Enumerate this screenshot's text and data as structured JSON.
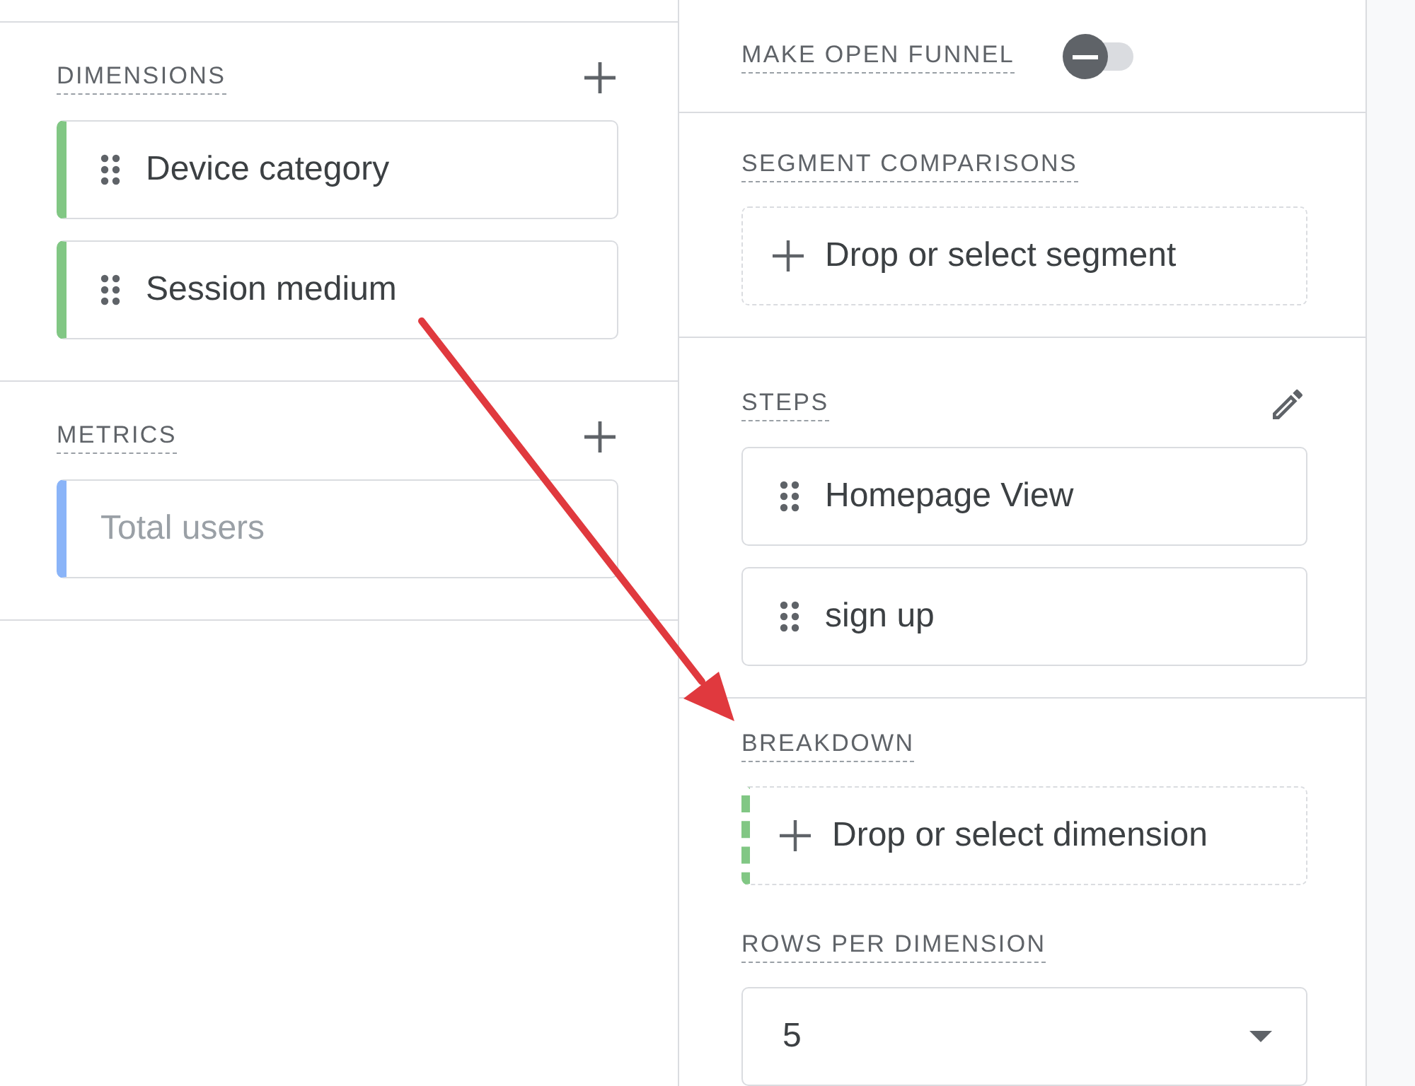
{
  "dimensions": {
    "label": "DIMENSIONS",
    "items": [
      {
        "label": "Device category",
        "color": "#81c784",
        "disabled": false
      },
      {
        "label": "Session medium",
        "color": "#81c784",
        "disabled": false
      }
    ]
  },
  "metrics": {
    "label": "METRICS",
    "items": [
      {
        "label": "Total users",
        "color": "#8ab4f8",
        "disabled": true
      }
    ]
  },
  "open_funnel": {
    "label": "MAKE OPEN FUNNEL",
    "on": false
  },
  "segment_comparisons": {
    "label": "SEGMENT COMPARISONS",
    "drop_target": "Drop or select segment"
  },
  "steps": {
    "label": "STEPS",
    "items": [
      {
        "label": "Homepage View"
      },
      {
        "label": "sign up"
      }
    ]
  },
  "breakdown": {
    "label": "BREAKDOWN",
    "drop_target": "Drop or select dimension"
  },
  "rows_per_dimension": {
    "label": "ROWS PER DIMENSION",
    "value": "5"
  }
}
